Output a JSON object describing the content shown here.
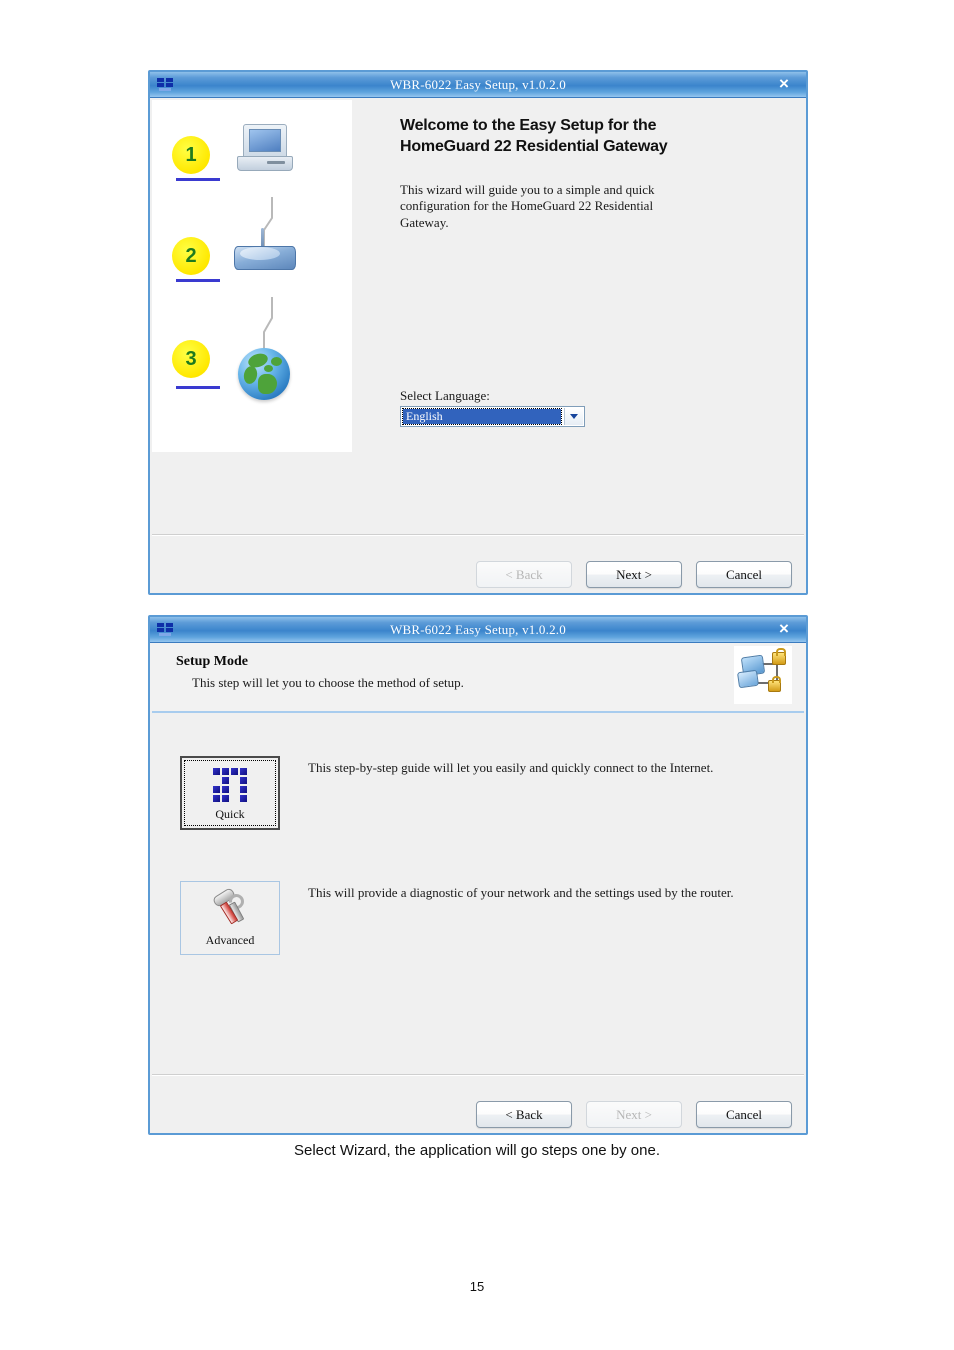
{
  "document": {
    "caption": "Select Wizard, the application will go steps one by one.",
    "page_number": "15"
  },
  "dialog1": {
    "titlebar": {
      "title": "WBR-6022 Easy Setup, v1.0.2.0",
      "close_label": "×",
      "icon": "network-device-icon"
    },
    "steps": [
      {
        "number": "1",
        "icon": "computer-icon"
      },
      {
        "number": "2",
        "icon": "router-icon"
      },
      {
        "number": "3",
        "icon": "globe-icon"
      }
    ],
    "heading_line1": "Welcome to the Easy Setup for the",
    "heading_line2": "HomeGuard 22 Residential Gateway",
    "paragraph": "This wizard will guide you to a simple and quick configuration for the HomeGuard 22 Residential Gateway.",
    "language": {
      "label": "Select Language:",
      "selected": "English",
      "options": [
        "English"
      ]
    },
    "buttons": {
      "back": "< Back",
      "next": "Next >",
      "cancel": "Cancel"
    }
  },
  "dialog2": {
    "titlebar": {
      "title": "WBR-6022 Easy Setup, v1.0.2.0",
      "close_label": "×",
      "icon": "network-device-icon"
    },
    "header": {
      "title": "Setup Mode",
      "subtitle": "This step will let you to choose the method of setup.",
      "icon": "network-security-icon"
    },
    "options": [
      {
        "label": "Quick",
        "icon": "quick-blocks-icon",
        "description": "This step-by-step guide will let you easily and quickly connect to the Internet."
      },
      {
        "label": "Advanced",
        "icon": "wrench-screwdriver-icon",
        "description": "This will provide a diagnostic of your network and the settings used by the router."
      }
    ],
    "buttons": {
      "back": "< Back",
      "next": "Next >",
      "cancel": "Cancel"
    }
  },
  "colors": {
    "title_bar_blue": "#3b84cc",
    "dialog_border": "#5b9bd5",
    "step_circle": "#ffee00",
    "step_number": "#1e7a1e",
    "underline": "#3a3ad0",
    "combo_highlight": "#3163bd",
    "separator_blue": "#a8ccee"
  }
}
